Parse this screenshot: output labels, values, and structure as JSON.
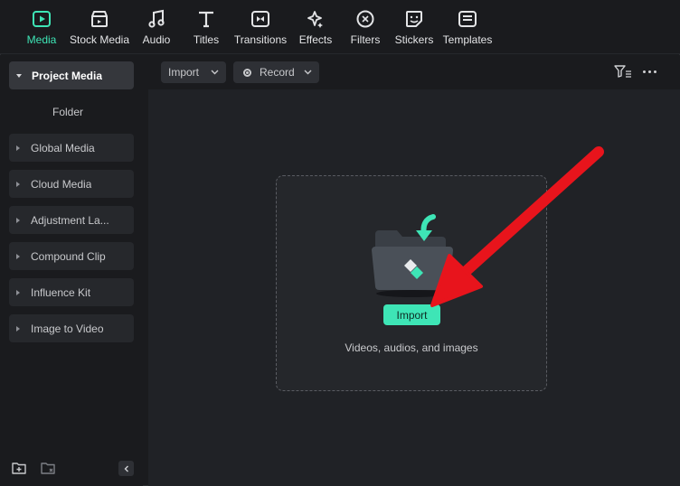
{
  "toolbar": {
    "tabs": [
      {
        "label": "Media",
        "icon": "media-icon"
      },
      {
        "label": "Stock Media",
        "icon": "stock-media-icon"
      },
      {
        "label": "Audio",
        "icon": "music-note-icon"
      },
      {
        "label": "Titles",
        "icon": "text-t-icon"
      },
      {
        "label": "Transitions",
        "icon": "transition-icon"
      },
      {
        "label": "Effects",
        "icon": "sparkle-icon"
      },
      {
        "label": "Filters",
        "icon": "filter-lens-icon"
      },
      {
        "label": "Stickers",
        "icon": "sticker-icon"
      },
      {
        "label": "Templates",
        "icon": "template-icon"
      }
    ],
    "active": "Media"
  },
  "sidebar": {
    "project_media": "Project Media",
    "folder": "Folder",
    "items": [
      {
        "label": "Global Media"
      },
      {
        "label": "Cloud Media"
      },
      {
        "label": "Adjustment La..."
      },
      {
        "label": "Compound Clip"
      },
      {
        "label": "Influence Kit"
      },
      {
        "label": "Image to Video"
      }
    ]
  },
  "content_toolbar": {
    "import_label": "Import",
    "record_label": "Record"
  },
  "dropzone": {
    "import_button": "Import",
    "hint": "Videos, audios, and images"
  },
  "colors": {
    "accent": "#3ee5b6",
    "annotation_arrow": "#e8141c",
    "background": "#1a1b1e",
    "panel": "#202226"
  }
}
